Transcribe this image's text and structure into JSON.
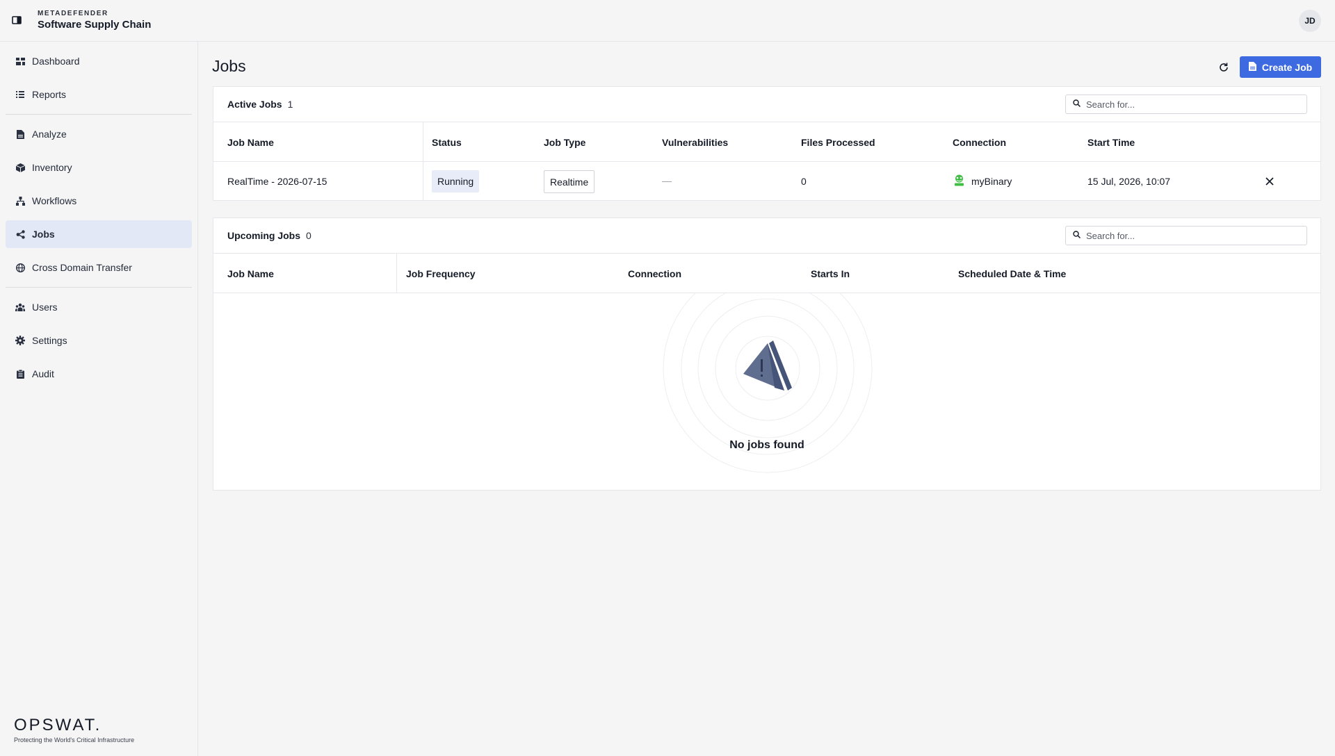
{
  "app": {
    "brand_top": "METADEFENDER",
    "brand_title": "Software Supply Chain",
    "avatar": "JD"
  },
  "sidebar": {
    "items": [
      {
        "label": "Dashboard",
        "icon": "dashboard-icon"
      },
      {
        "label": "Reports",
        "icon": "list-icon"
      },
      {
        "label": "Analyze",
        "icon": "document-icon"
      },
      {
        "label": "Inventory",
        "icon": "cube-icon"
      },
      {
        "label": "Workflows",
        "icon": "workflow-icon"
      },
      {
        "label": "Jobs",
        "icon": "share-icon",
        "active": true
      },
      {
        "label": "Cross Domain Transfer",
        "icon": "globe-icon"
      },
      {
        "label": "Users",
        "icon": "users-icon"
      },
      {
        "label": "Settings",
        "icon": "gear-icon"
      },
      {
        "label": "Audit",
        "icon": "clipboard-icon"
      }
    ],
    "footer_logo": "OPSWAT.",
    "footer_tagline": "Protecting the World's Critical Infrastructure"
  },
  "main": {
    "title": "Jobs",
    "create_button": "Create Job",
    "accent_color": "#3d6ae0"
  },
  "active_jobs": {
    "title": "Active Jobs",
    "count": "1",
    "search_placeholder": "Search for...",
    "columns": [
      "Job Name",
      "Status",
      "Job Type",
      "Vulnerabilities",
      "Files Processed",
      "Connection",
      "Start Time"
    ],
    "rows": [
      {
        "job_name": "RealTime - 2026-07-15",
        "status": "Running",
        "job_type": "Realtime",
        "vulnerabilities": "—",
        "files_processed": "0",
        "connection": "myBinary",
        "start_time": "15 Jul, 2026, 10:07"
      }
    ]
  },
  "upcoming_jobs": {
    "title": "Upcoming Jobs",
    "count": "0",
    "search_placeholder": "Search for...",
    "columns": [
      "Job Name",
      "Job Frequency",
      "Connection",
      "Starts In",
      "Scheduled Date & Time"
    ],
    "empty_text": "No jobs found"
  }
}
